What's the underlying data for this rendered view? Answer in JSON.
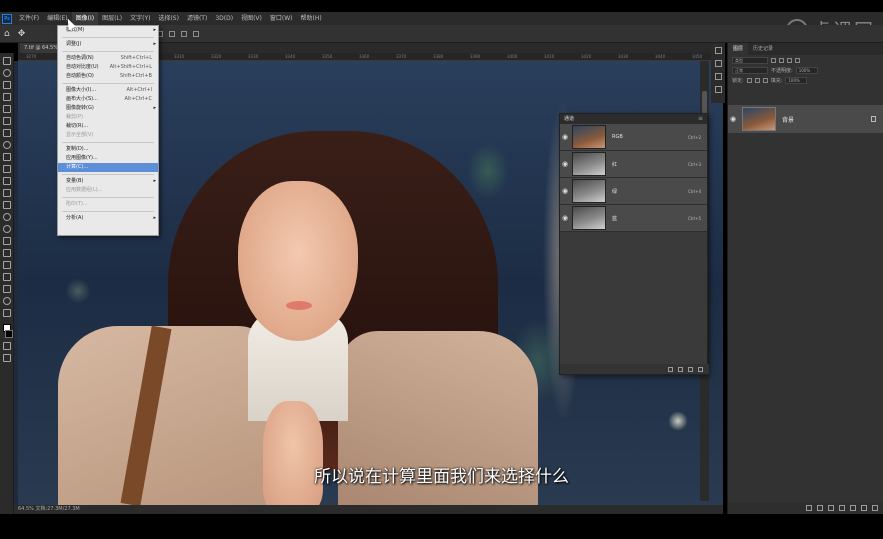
{
  "menubar": {
    "items": [
      "文件(F)",
      "编辑(E)",
      "图像(I)",
      "图层(L)",
      "文字(Y)",
      "选择(S)",
      "滤镜(T)",
      "3D(D)",
      "视图(V)",
      "窗口(W)",
      "帮助(H)"
    ],
    "active_index": 2
  },
  "watermark": {
    "text": "虎课网"
  },
  "document": {
    "tab_title": "7.tif @ 64.5% (RGB/8#)"
  },
  "ruler": {
    "ticks": [
      "3270",
      "3280",
      "3290",
      "3300",
      "3310",
      "3320",
      "3330",
      "3340",
      "3350",
      "3360",
      "3370",
      "3380",
      "3390",
      "3400",
      "3410",
      "3420",
      "3430",
      "3440",
      "3450"
    ]
  },
  "edit_menu": {
    "items": [
      {
        "label": "模式(M)",
        "shortcut": "",
        "disabled": false,
        "submenu": true
      },
      {
        "sep": true
      },
      {
        "label": "调整(J)",
        "shortcut": "",
        "disabled": false,
        "submenu": true
      },
      {
        "sep": true
      },
      {
        "label": "自动色调(N)",
        "shortcut": "Shift+Ctrl+L",
        "disabled": false
      },
      {
        "label": "自动对比度(U)",
        "shortcut": "Alt+Shift+Ctrl+L",
        "disabled": false
      },
      {
        "label": "自动颜色(O)",
        "shortcut": "Shift+Ctrl+B",
        "disabled": false
      },
      {
        "sep": true
      },
      {
        "label": "图像大小(I)...",
        "shortcut": "Alt+Ctrl+I",
        "disabled": false
      },
      {
        "label": "画布大小(S)...",
        "shortcut": "Alt+Ctrl+C",
        "disabled": false
      },
      {
        "label": "图像旋转(G)",
        "shortcut": "",
        "disabled": false,
        "submenu": true
      },
      {
        "label": "裁剪(P)",
        "shortcut": "",
        "disabled": true
      },
      {
        "label": "裁切(R)...",
        "shortcut": "",
        "disabled": false
      },
      {
        "label": "显示全部(V)",
        "shortcut": "",
        "disabled": true
      },
      {
        "sep": true
      },
      {
        "label": "复制(D)...",
        "shortcut": "",
        "disabled": false
      },
      {
        "label": "应用图像(Y)...",
        "shortcut": "",
        "disabled": false
      },
      {
        "label": "计算(C)...",
        "shortcut": "",
        "disabled": false,
        "highlight": true
      },
      {
        "sep": true
      },
      {
        "label": "变量(B)",
        "shortcut": "",
        "disabled": false,
        "submenu": true
      },
      {
        "label": "应用数据组(L)...",
        "shortcut": "",
        "disabled": true
      },
      {
        "sep": true
      },
      {
        "label": "陷印(T)...",
        "shortcut": "",
        "disabled": true
      },
      {
        "sep": true
      },
      {
        "label": "分析(A)",
        "shortcut": "",
        "disabled": false,
        "submenu": true
      }
    ]
  },
  "channels_panel": {
    "title": "通道",
    "channels": [
      {
        "name": "RGB",
        "shortcut": "Ctrl+2",
        "thumb": "rgb"
      },
      {
        "name": "红",
        "shortcut": "Ctrl+3",
        "thumb": "gray"
      },
      {
        "name": "绿",
        "shortcut": "Ctrl+4",
        "thumb": "gray"
      },
      {
        "name": "蓝",
        "shortcut": "Ctrl+5",
        "thumb": "gray"
      }
    ]
  },
  "layers_panel": {
    "tabs": [
      "图层",
      "历史记录"
    ],
    "kind_label": "类型",
    "blend_mode": "正常",
    "opacity_label": "不透明度:",
    "opacity_value": "100%",
    "lock_label": "锁定:",
    "fill_label": "填充:",
    "fill_value": "100%",
    "layer_name": "背景"
  },
  "status": {
    "text": "64.5%   文档:27.3M/27.3M"
  },
  "subtitle": {
    "text": "所以说在计算里面我们来选择什么"
  }
}
